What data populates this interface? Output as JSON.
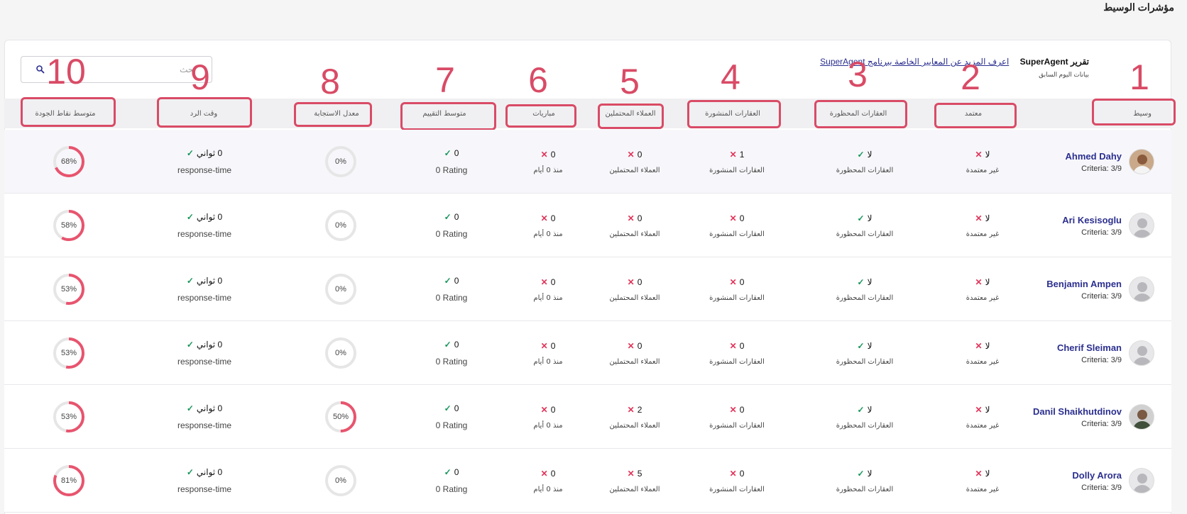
{
  "page_title": "مؤشرات الوسيط",
  "report": {
    "title": "تقرير SuperAgent",
    "learn_more_link": "اعرف المزيد عن المعايير الخاصة ببرنامج SuperAgent",
    "subtitle": "بيانات اليوم السابق"
  },
  "search": {
    "placeholder": "بحث"
  },
  "annotation_numbers": [
    "1",
    "2",
    "3",
    "4",
    "5",
    "6",
    "7",
    "8",
    "9",
    "10"
  ],
  "columns": {
    "agent": "وسيط",
    "certified": "معتمد",
    "banned": "العقارات المحظورة",
    "published": "العقارات المنشورة",
    "leads": "العملاء المحتملين",
    "matches": "مباريات",
    "rating": "متوسط التقييم",
    "response_rate": "معدل الاستجابة",
    "response_time": "وقت الرد",
    "quality": "متوسط نقاط الجودة"
  },
  "sub_labels": {
    "certified": "غير معتمدة",
    "banned": "العقارات المحظورة",
    "published": "العقارات المنشورة",
    "leads": "العملاء المحتملين",
    "matches": "منذ 0 أيام",
    "rating": "0 Rating",
    "response_time": "response-time"
  },
  "colors": {
    "accent_red": "#d94b66",
    "ring_red": "#e8546e",
    "ring_track": "#e6e6e6",
    "name_blue": "#2b2f8f",
    "check_green": "#16965a",
    "x_red": "#e0355a"
  },
  "rows": [
    {
      "name": "Ahmed Dahy",
      "criteria": "Criteria: 3/9",
      "avatar": "photo",
      "certified": "لا",
      "banned": "لا",
      "published": "1",
      "leads": "0",
      "matches": "0",
      "rating": "0",
      "response_rate": 0,
      "response_rate_label": "0%",
      "response_time": "0 ثواني",
      "quality": 68,
      "quality_label": "68%"
    },
    {
      "name": "Ari Kesisoglu",
      "criteria": "Criteria: 3/9",
      "avatar": "placeholder",
      "certified": "لا",
      "banned": "لا",
      "published": "0",
      "leads": "0",
      "matches": "0",
      "rating": "0",
      "response_rate": 0,
      "response_rate_label": "0%",
      "response_time": "0 ثواني",
      "quality": 58,
      "quality_label": "58%"
    },
    {
      "name": "Benjamin Ampen",
      "criteria": "Criteria: 3/9",
      "avatar": "placeholder",
      "certified": "لا",
      "banned": "لا",
      "published": "0",
      "leads": "0",
      "matches": "0",
      "rating": "0",
      "response_rate": 0,
      "response_rate_label": "0%",
      "response_time": "0 ثواني",
      "quality": 53,
      "quality_label": "53%"
    },
    {
      "name": "Cherif Sleiman",
      "criteria": "Criteria: 3/9",
      "avatar": "placeholder",
      "certified": "لا",
      "banned": "لا",
      "published": "0",
      "leads": "0",
      "matches": "0",
      "rating": "0",
      "response_rate": 0,
      "response_rate_label": "0%",
      "response_time": "0 ثواني",
      "quality": 53,
      "quality_label": "53%"
    },
    {
      "name": "Danil Shaikhutdinov",
      "criteria": "Criteria: 3/9",
      "avatar": "photo",
      "certified": "لا",
      "banned": "لا",
      "published": "0",
      "leads": "2",
      "matches": "0",
      "rating": "0",
      "response_rate": 50,
      "response_rate_label": "50%",
      "response_time": "0 ثواني",
      "quality": 53,
      "quality_label": "53%"
    },
    {
      "name": "Dolly Arora",
      "criteria": "Criteria: 3/9",
      "avatar": "placeholder",
      "certified": "لا",
      "banned": "لا",
      "published": "0",
      "leads": "5",
      "matches": "0",
      "rating": "0",
      "response_rate": 0,
      "response_rate_label": "0%",
      "response_time": "0 ثواني",
      "quality": 81,
      "quality_label": "81%"
    }
  ]
}
